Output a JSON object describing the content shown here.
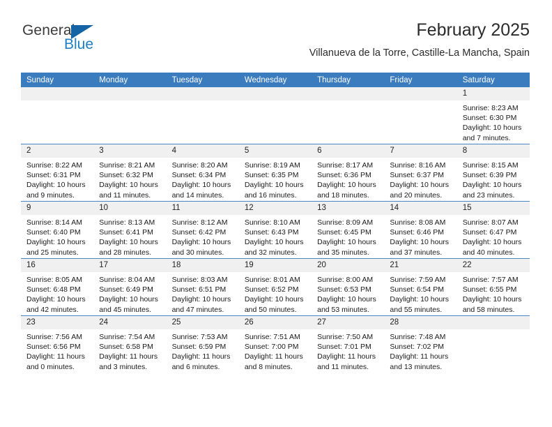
{
  "brand": {
    "name_part1": "General",
    "name_part2": "Blue",
    "triangle_icon": "blue-triangle-logo-mark",
    "colors": {
      "general_text": "#3b3b3b",
      "blue_text": "#1d7fc4",
      "triangle": "#1464a5"
    }
  },
  "header": {
    "title": "February 2025",
    "subtitle": "Villanueva de la Torre, Castille-La Mancha, Spain"
  },
  "theme": {
    "header_row_bg": "#3a7cbe",
    "header_row_text": "#ffffff",
    "row_border": "#4a86c4",
    "daynum_bg": "#f0f0f0",
    "cell_bg": "#ffffff"
  },
  "weekdays": [
    "Sunday",
    "Monday",
    "Tuesday",
    "Wednesday",
    "Thursday",
    "Friday",
    "Saturday"
  ],
  "weeks": [
    [
      {
        "day": "",
        "blank": true
      },
      {
        "day": "",
        "blank": true
      },
      {
        "day": "",
        "blank": true
      },
      {
        "day": "",
        "blank": true
      },
      {
        "day": "",
        "blank": true
      },
      {
        "day": "",
        "blank": true
      },
      {
        "day": "1",
        "sunrise": "Sunrise: 8:23 AM",
        "sunset": "Sunset: 6:30 PM",
        "daylight": "Daylight: 10 hours and 7 minutes."
      }
    ],
    [
      {
        "day": "2",
        "sunrise": "Sunrise: 8:22 AM",
        "sunset": "Sunset: 6:31 PM",
        "daylight": "Daylight: 10 hours and 9 minutes."
      },
      {
        "day": "3",
        "sunrise": "Sunrise: 8:21 AM",
        "sunset": "Sunset: 6:32 PM",
        "daylight": "Daylight: 10 hours and 11 minutes."
      },
      {
        "day": "4",
        "sunrise": "Sunrise: 8:20 AM",
        "sunset": "Sunset: 6:34 PM",
        "daylight": "Daylight: 10 hours and 14 minutes."
      },
      {
        "day": "5",
        "sunrise": "Sunrise: 8:19 AM",
        "sunset": "Sunset: 6:35 PM",
        "daylight": "Daylight: 10 hours and 16 minutes."
      },
      {
        "day": "6",
        "sunrise": "Sunrise: 8:17 AM",
        "sunset": "Sunset: 6:36 PM",
        "daylight": "Daylight: 10 hours and 18 minutes."
      },
      {
        "day": "7",
        "sunrise": "Sunrise: 8:16 AM",
        "sunset": "Sunset: 6:37 PM",
        "daylight": "Daylight: 10 hours and 20 minutes."
      },
      {
        "day": "8",
        "sunrise": "Sunrise: 8:15 AM",
        "sunset": "Sunset: 6:39 PM",
        "daylight": "Daylight: 10 hours and 23 minutes."
      }
    ],
    [
      {
        "day": "9",
        "sunrise": "Sunrise: 8:14 AM",
        "sunset": "Sunset: 6:40 PM",
        "daylight": "Daylight: 10 hours and 25 minutes."
      },
      {
        "day": "10",
        "sunrise": "Sunrise: 8:13 AM",
        "sunset": "Sunset: 6:41 PM",
        "daylight": "Daylight: 10 hours and 28 minutes."
      },
      {
        "day": "11",
        "sunrise": "Sunrise: 8:12 AM",
        "sunset": "Sunset: 6:42 PM",
        "daylight": "Daylight: 10 hours and 30 minutes."
      },
      {
        "day": "12",
        "sunrise": "Sunrise: 8:10 AM",
        "sunset": "Sunset: 6:43 PM",
        "daylight": "Daylight: 10 hours and 32 minutes."
      },
      {
        "day": "13",
        "sunrise": "Sunrise: 8:09 AM",
        "sunset": "Sunset: 6:45 PM",
        "daylight": "Daylight: 10 hours and 35 minutes."
      },
      {
        "day": "14",
        "sunrise": "Sunrise: 8:08 AM",
        "sunset": "Sunset: 6:46 PM",
        "daylight": "Daylight: 10 hours and 37 minutes."
      },
      {
        "day": "15",
        "sunrise": "Sunrise: 8:07 AM",
        "sunset": "Sunset: 6:47 PM",
        "daylight": "Daylight: 10 hours and 40 minutes."
      }
    ],
    [
      {
        "day": "16",
        "sunrise": "Sunrise: 8:05 AM",
        "sunset": "Sunset: 6:48 PM",
        "daylight": "Daylight: 10 hours and 42 minutes."
      },
      {
        "day": "17",
        "sunrise": "Sunrise: 8:04 AM",
        "sunset": "Sunset: 6:49 PM",
        "daylight": "Daylight: 10 hours and 45 minutes."
      },
      {
        "day": "18",
        "sunrise": "Sunrise: 8:03 AM",
        "sunset": "Sunset: 6:51 PM",
        "daylight": "Daylight: 10 hours and 47 minutes."
      },
      {
        "day": "19",
        "sunrise": "Sunrise: 8:01 AM",
        "sunset": "Sunset: 6:52 PM",
        "daylight": "Daylight: 10 hours and 50 minutes."
      },
      {
        "day": "20",
        "sunrise": "Sunrise: 8:00 AM",
        "sunset": "Sunset: 6:53 PM",
        "daylight": "Daylight: 10 hours and 53 minutes."
      },
      {
        "day": "21",
        "sunrise": "Sunrise: 7:59 AM",
        "sunset": "Sunset: 6:54 PM",
        "daylight": "Daylight: 10 hours and 55 minutes."
      },
      {
        "day": "22",
        "sunrise": "Sunrise: 7:57 AM",
        "sunset": "Sunset: 6:55 PM",
        "daylight": "Daylight: 10 hours and 58 minutes."
      }
    ],
    [
      {
        "day": "23",
        "sunrise": "Sunrise: 7:56 AM",
        "sunset": "Sunset: 6:56 PM",
        "daylight": "Daylight: 11 hours and 0 minutes."
      },
      {
        "day": "24",
        "sunrise": "Sunrise: 7:54 AM",
        "sunset": "Sunset: 6:58 PM",
        "daylight": "Daylight: 11 hours and 3 minutes."
      },
      {
        "day": "25",
        "sunrise": "Sunrise: 7:53 AM",
        "sunset": "Sunset: 6:59 PM",
        "daylight": "Daylight: 11 hours and 6 minutes."
      },
      {
        "day": "26",
        "sunrise": "Sunrise: 7:51 AM",
        "sunset": "Sunset: 7:00 PM",
        "daylight": "Daylight: 11 hours and 8 minutes."
      },
      {
        "day": "27",
        "sunrise": "Sunrise: 7:50 AM",
        "sunset": "Sunset: 7:01 PM",
        "daylight": "Daylight: 11 hours and 11 minutes."
      },
      {
        "day": "28",
        "sunrise": "Sunrise: 7:48 AM",
        "sunset": "Sunset: 7:02 PM",
        "daylight": "Daylight: 11 hours and 13 minutes."
      },
      {
        "day": "",
        "blank": true
      }
    ]
  ]
}
